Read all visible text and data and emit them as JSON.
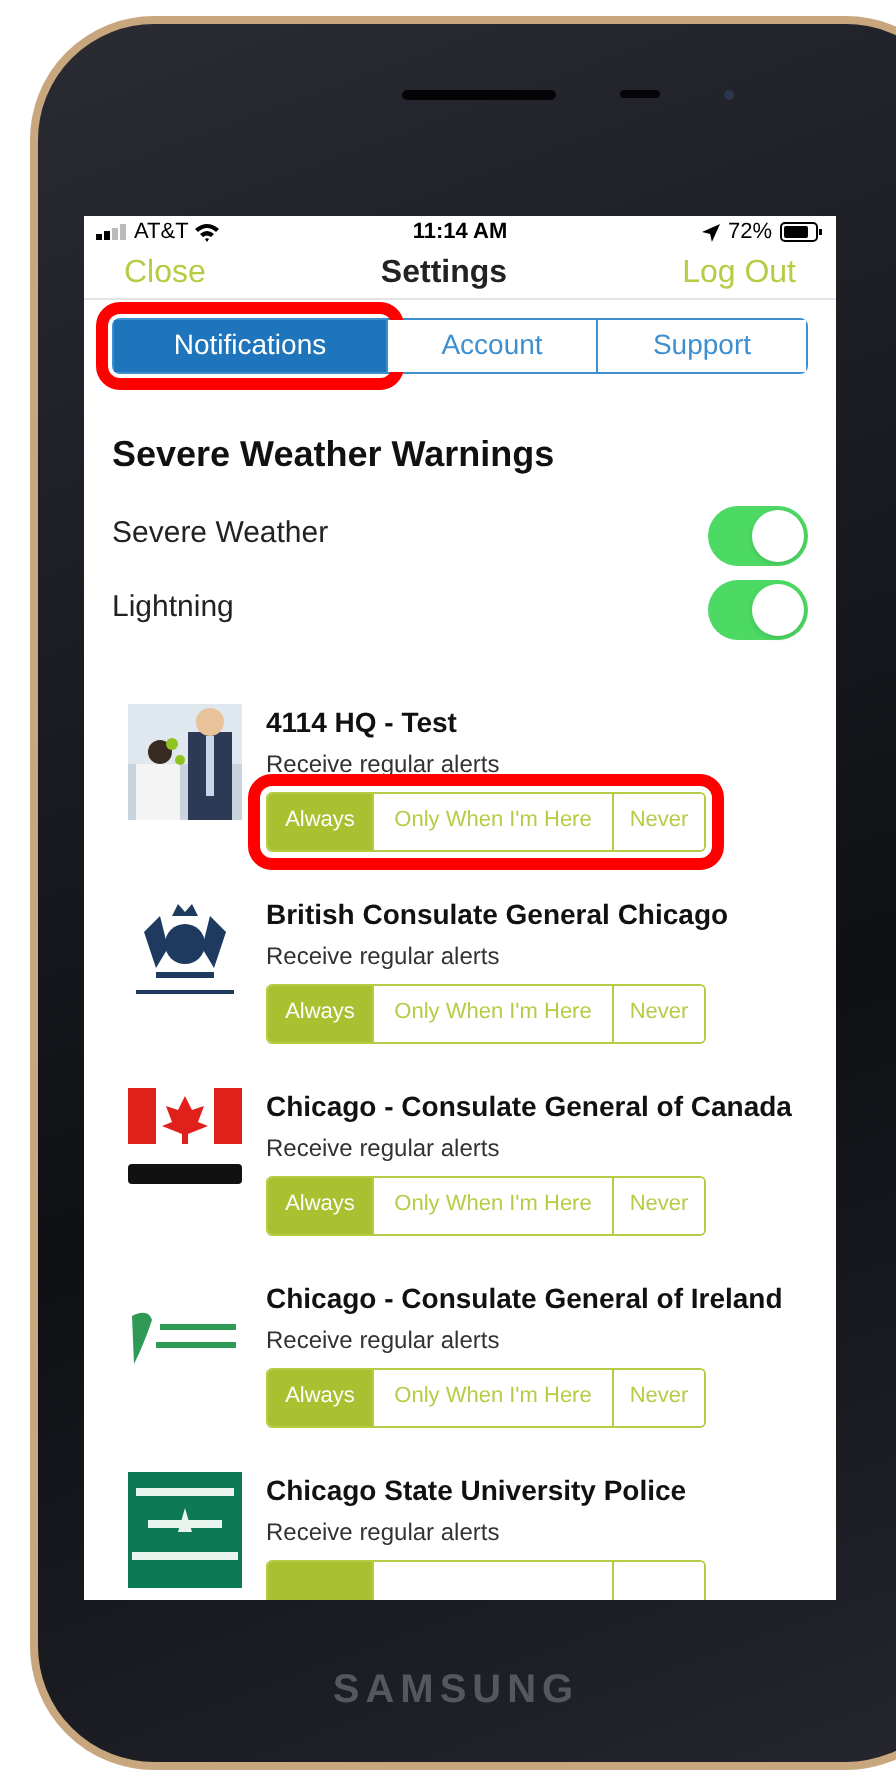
{
  "status_bar": {
    "carrier": "AT&T",
    "time": "11:14 AM",
    "battery": "72%"
  },
  "nav": {
    "left": "Close",
    "title": "Settings",
    "right": "Log Out"
  },
  "tabs": [
    {
      "label": "Notifications",
      "selected": true,
      "highlighted": true
    },
    {
      "label": "Account",
      "selected": false,
      "highlighted": false
    },
    {
      "label": "Support",
      "selected": false,
      "highlighted": false
    }
  ],
  "section": {
    "title": "Severe Weather Warnings",
    "toggles": [
      {
        "label": "Severe Weather",
        "on": true
      },
      {
        "label": "Lightning",
        "on": true
      }
    ]
  },
  "channels": [
    {
      "name": "4114 HQ - Test",
      "subtitle": "Receive regular alerts",
      "highlighted": true,
      "modes": [
        {
          "label": "Always",
          "selected": true
        },
        {
          "label": "Only When I'm Here",
          "selected": false
        },
        {
          "label": "Never",
          "selected": false
        }
      ]
    },
    {
      "name": "British Consulate General Chicago",
      "subtitle": "Receive regular alerts",
      "highlighted": false,
      "modes": [
        {
          "label": "Always",
          "selected": true
        },
        {
          "label": "Only When I'm Here",
          "selected": false
        },
        {
          "label": "Never",
          "selected": false
        }
      ]
    },
    {
      "name": "Chicago - Consulate General of Canada",
      "subtitle": "Receive regular alerts",
      "highlighted": false,
      "modes": [
        {
          "label": "Always",
          "selected": true
        },
        {
          "label": "Only When I'm Here",
          "selected": false
        },
        {
          "label": "Never",
          "selected": false
        }
      ]
    },
    {
      "name": "Chicago - Consulate General of Ireland",
      "subtitle": "Receive regular alerts",
      "highlighted": false,
      "modes": [
        {
          "label": "Always",
          "selected": true
        },
        {
          "label": "Only When I'm Here",
          "selected": false
        },
        {
          "label": "Never",
          "selected": false
        }
      ]
    },
    {
      "name": "Chicago State University Police",
      "subtitle": "Receive regular alerts",
      "highlighted": false,
      "modes": [
        {
          "selected": true
        },
        {
          "selected": false
        },
        {
          "selected": false
        }
      ]
    }
  ],
  "device": {
    "brand": "SAMSUNG"
  }
}
